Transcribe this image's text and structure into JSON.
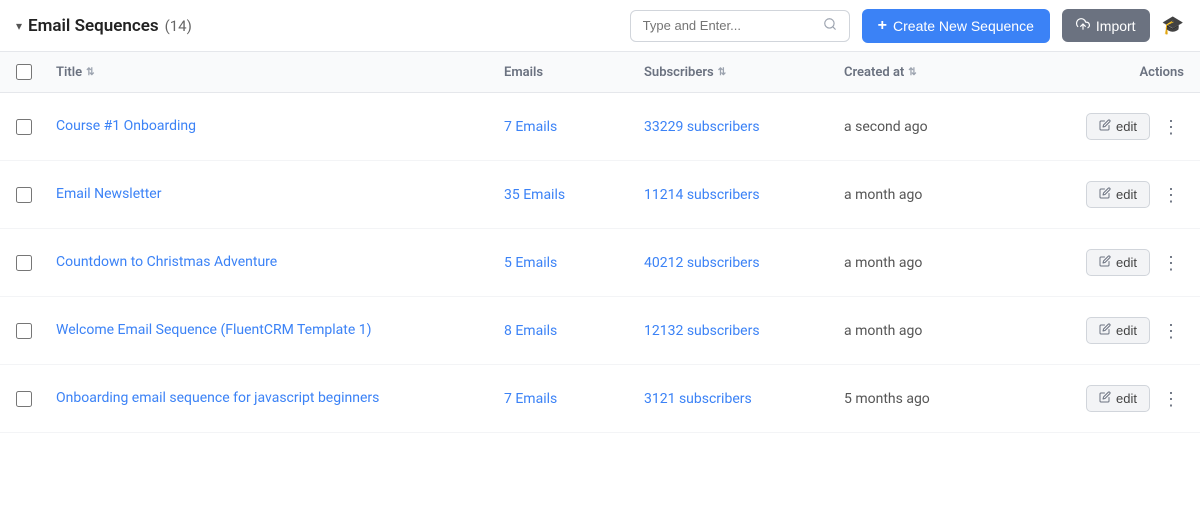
{
  "header": {
    "title": "Email Sequences",
    "count": "(14)",
    "search_placeholder": "Type and Enter...",
    "create_label": "Create New Sequence",
    "import_label": "Import"
  },
  "table": {
    "columns": {
      "title": "Title",
      "emails": "Emails",
      "subscribers": "Subscribers",
      "created_at": "Created at",
      "actions": "Actions"
    },
    "rows": [
      {
        "title": "Course #1 Onboarding",
        "emails": "7 Emails",
        "subscribers": "33229 subscribers",
        "created_at": "a second ago"
      },
      {
        "title": "Email Newsletter",
        "emails": "35 Emails",
        "subscribers": "11214 subscribers",
        "created_at": "a month ago"
      },
      {
        "title": "Countdown to Christmas Adventure",
        "emails": "5 Emails",
        "subscribers": "40212 subscribers",
        "created_at": "a month ago"
      },
      {
        "title": "Welcome Email Sequence (FluentCRM Template 1)",
        "emails": "8 Emails",
        "subscribers": "12132 subscribers",
        "created_at": "a month ago"
      },
      {
        "title": "Onboarding email sequence for javascript beginners",
        "emails": "7 Emails",
        "subscribers": "3121 subscribers",
        "created_at": "5 months ago"
      }
    ],
    "edit_label": "edit"
  }
}
